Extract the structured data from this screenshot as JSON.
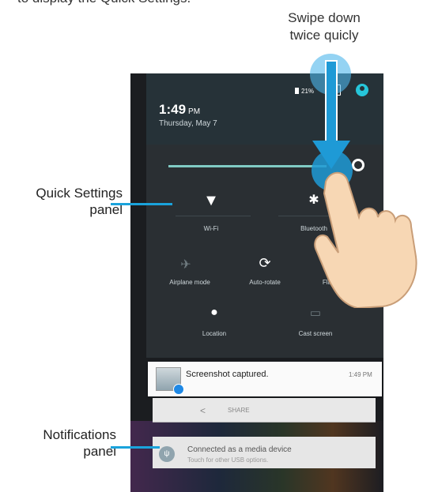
{
  "captions": {
    "top": "to display the Quick Settings.",
    "swipe_line1": "Swipe down",
    "swipe_line2": "twice quicly"
  },
  "status_bar": {
    "battery": "21%"
  },
  "header": {
    "time": "1:49",
    "ampm": "PM",
    "date": "Thursday, May 7"
  },
  "quick_settings": {
    "tiles": [
      {
        "label": "Wi-Fi",
        "icon": "wifi-icon"
      },
      {
        "label": "Bluetooth",
        "icon": "bluetooth-icon"
      },
      {
        "label": "Airplane mode",
        "icon": "airplane-icon"
      },
      {
        "label": "Auto-rotate",
        "icon": "auto-rotate-icon"
      },
      {
        "label": "Flashlight",
        "icon": "flashlight-icon"
      },
      {
        "label": "Location",
        "icon": "location-icon"
      },
      {
        "label": "Cast screen",
        "icon": "cast-icon"
      }
    ]
  },
  "notifications": {
    "screenshot": {
      "title": "Screenshot captured.",
      "time": "1:49 PM",
      "action": "SHARE"
    },
    "usb": {
      "title": "Connected as a media device",
      "subtitle": "Touch for other USB options."
    }
  },
  "annotations": {
    "quick_settings_line1": "Quick Settings",
    "quick_settings_line2": "panel",
    "notifications_line1": "Notifications",
    "notifications_line2": "panel"
  },
  "colors": {
    "accent": "#1e9ad6",
    "shade": "#2a2f33",
    "callout_line": "#1aa3dc"
  }
}
